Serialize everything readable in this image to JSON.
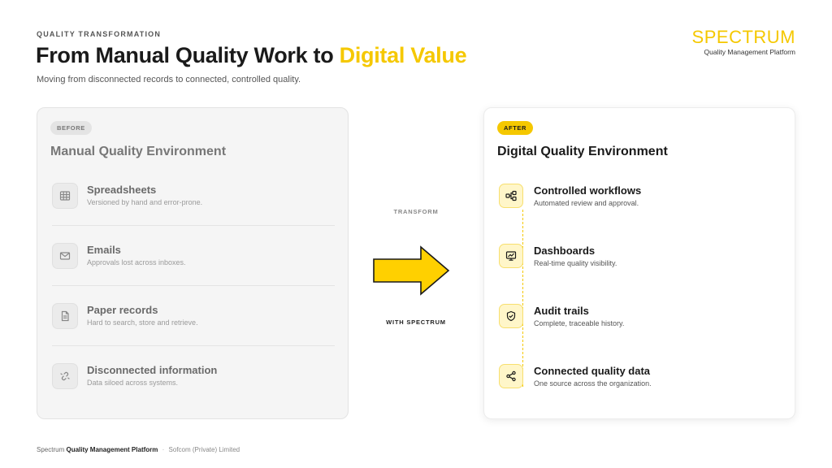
{
  "header": {
    "eyebrow": "QUALITY TRANSFORMATION",
    "title_main": "From Manual Quality Work to ",
    "title_highlight": "Digital Value",
    "subtitle": "Moving from disconnected records to connected, controlled quality."
  },
  "brand": {
    "name": "SPECTRUM",
    "tagline": "Quality Management Platform",
    "color": "#f5c800"
  },
  "before": {
    "badge": "BEFORE",
    "title": "Manual Quality Environment",
    "items": [
      {
        "icon": "table-icon",
        "title": "Spreadsheets",
        "desc": "Versioned by hand and error-prone."
      },
      {
        "icon": "mail-icon",
        "title": "Emails",
        "desc": "Approvals lost across inboxes."
      },
      {
        "icon": "document-icon",
        "title": "Paper records",
        "desc": "Hard to search, store and retrieve."
      },
      {
        "icon": "broken-link-icon",
        "title": "Disconnected information",
        "desc": "Data siloed across systems."
      }
    ]
  },
  "middle": {
    "top_label": "TRANSFORM",
    "bottom_label": "WITH SPECTRUM"
  },
  "after": {
    "badge": "AFTER",
    "title": "Digital Quality Environment",
    "items": [
      {
        "icon": "workflow-icon",
        "title": "Controlled workflows",
        "desc": "Automated review and approval."
      },
      {
        "icon": "dashboard-icon",
        "title": "Dashboards",
        "desc": "Real-time quality visibility."
      },
      {
        "icon": "shield-check-icon",
        "title": "Audit trails",
        "desc": "Complete, traceable history."
      },
      {
        "icon": "share-nodes-icon",
        "title": "Connected quality data",
        "desc": "One source across the organization."
      }
    ]
  },
  "footer": {
    "brand": "Spectrum",
    "product": "Quality Management Platform",
    "separator": "·",
    "company": "Sofcom (Private) Limited"
  }
}
